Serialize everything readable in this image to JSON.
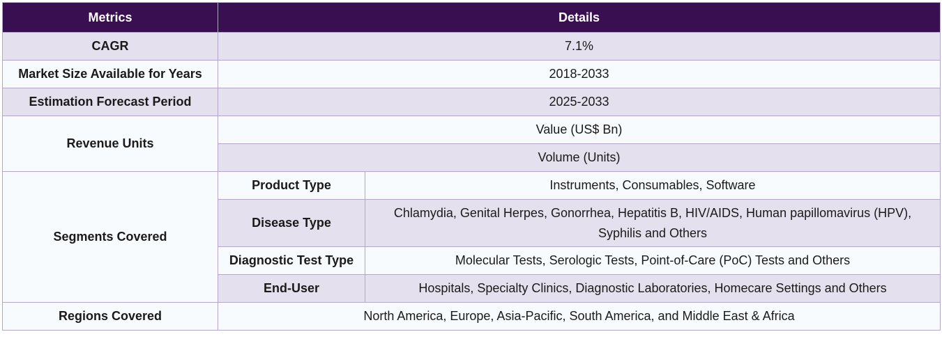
{
  "table": {
    "headers": {
      "metrics": "Metrics",
      "details": "Details"
    },
    "cagr": {
      "label": "CAGR",
      "value": "7.1%"
    },
    "market_size": {
      "label": "Market Size Available for Years",
      "value": "2018-2033"
    },
    "forecast": {
      "label": "Estimation Forecast Period",
      "value": "2025-2033"
    },
    "revenue_units": {
      "label": "Revenue Units",
      "values": [
        "Value (US$ Bn)",
        "Volume (Units)"
      ]
    },
    "segments": {
      "label": "Segments Covered",
      "rows": [
        {
          "name": "Product Type",
          "value": "Instruments, Consumables, Software"
        },
        {
          "name": "Disease Type",
          "value": "Chlamydia, Genital Herpes, Gonorrhea, Hepatitis B, HIV/AIDS, Human papillomavirus (HPV), Syphilis and Others"
        },
        {
          "name": "Diagnostic Test Type",
          "value": "Molecular Tests, Serologic Tests, Point-of-Care (PoC) Tests and Others"
        },
        {
          "name": "End-User",
          "value": "Hospitals, Specialty Clinics, Diagnostic Laboratories, Homecare Settings and Others"
        }
      ]
    },
    "regions": {
      "label": "Regions Covered",
      "value": "North America, Europe, Asia-Pacific, South America, and Middle East & Africa"
    }
  },
  "colors": {
    "header_bg": "#3a0f52",
    "header_text": "#ffffff",
    "shaded_row": "#e5e0ee",
    "white_row": "#f7fbfd",
    "border": "#b3a6c9"
  }
}
